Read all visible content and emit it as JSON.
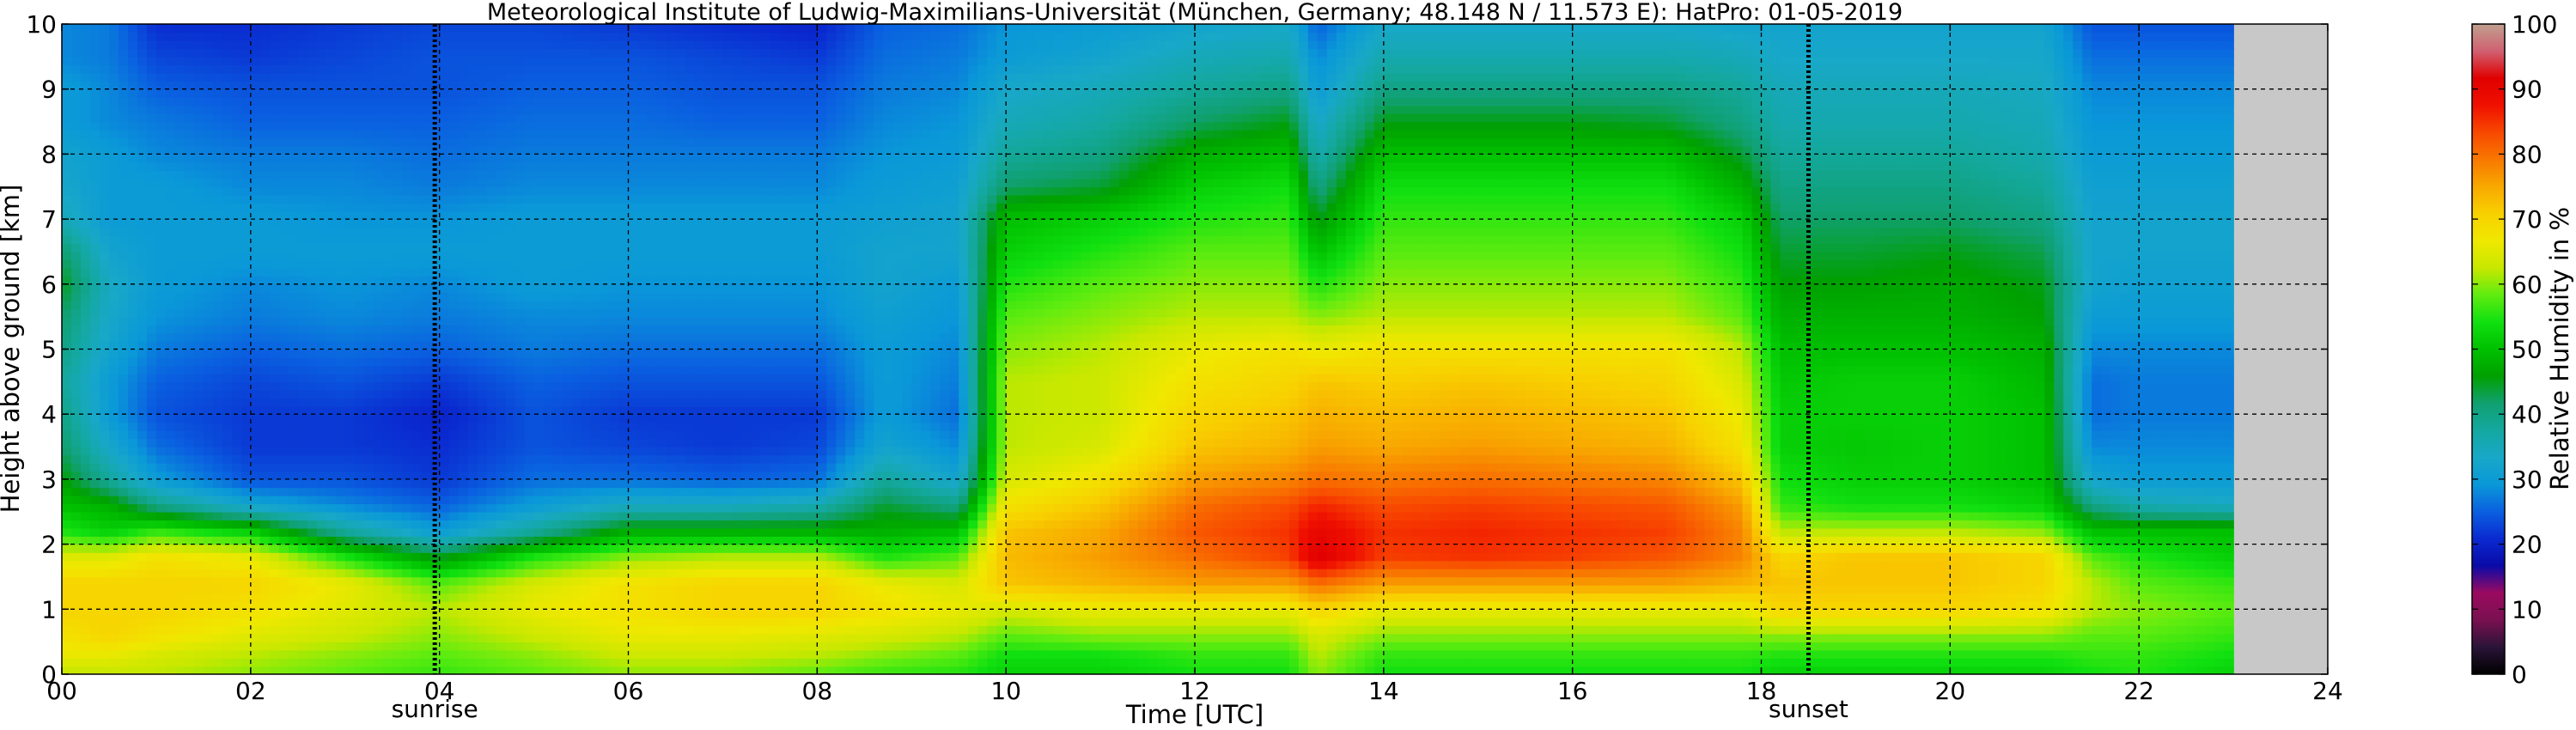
{
  "chart_data": {
    "type": "heatmap",
    "title": "Meteorological Institute of Ludwig-Maximilians-Universität (München, Germany; 48.148 N / 11.573 E):    HatPro: 01-05-2019",
    "xlabel": "Time [UTC]",
    "ylabel": "Height above ground [km]",
    "xlim": [
      0,
      24
    ],
    "ylim": [
      0,
      10
    ],
    "x_ticks": [
      0,
      2,
      4,
      6,
      8,
      10,
      12,
      14,
      16,
      18,
      20,
      22,
      24
    ],
    "x_tick_labels": [
      "00",
      "02",
      "04",
      "06",
      "08",
      "10",
      "12",
      "14",
      "16",
      "18",
      "20",
      "22",
      "24"
    ],
    "y_ticks": [
      0,
      1,
      2,
      3,
      4,
      5,
      6,
      7,
      8,
      9,
      10
    ],
    "y_tick_labels": [
      "0",
      "1",
      "2",
      "3",
      "4",
      "5",
      "6",
      "7",
      "8",
      "9",
      "10"
    ],
    "grid": true,
    "data_end_hour": 23.0,
    "colorbar": {
      "label": "Relative Humidity in %",
      "range": [
        0,
        100
      ],
      "ticks": [
        0,
        10,
        20,
        30,
        40,
        50,
        60,
        70,
        80,
        90,
        100
      ],
      "tick_labels": [
        "0",
        "10",
        "20",
        "30",
        "40",
        "50",
        "60",
        "70",
        "80",
        "90",
        "100"
      ],
      "colors": [
        "#000000",
        "#2a1438",
        "#7a1050",
        "#9a0a60",
        "#0a0aa8",
        "#0a2ad0",
        "#0a60e0",
        "#0a98d8",
        "#18a8c8",
        "#14a8a0",
        "#10a070",
        "#00a000",
        "#00c000",
        "#10e010",
        "#60ec10",
        "#c8e800",
        "#f0e800",
        "#f8d000",
        "#f8a800",
        "#f87800",
        "#f84800",
        "#f01000",
        "#e00000",
        "#d06070",
        "#c0a090"
      ]
    },
    "annotations": [
      {
        "x": 3.95,
        "label": "sunrise"
      },
      {
        "x": 18.5,
        "label": "sunset"
      }
    ],
    "profile_heights_km": [
      0.0,
      0.3,
      0.6,
      1.0,
      1.4,
      1.8,
      2.2,
      2.6,
      3.0,
      3.5,
      4.0,
      4.5,
      5.0,
      5.5,
      6.0,
      6.5,
      7.0,
      7.5,
      8.0,
      8.5,
      9.0,
      9.5,
      10.0
    ],
    "profiles": [
      {
        "time": 0.0,
        "rh": [
          62,
          66,
          68,
          70,
          70,
          65,
          55,
          50,
          46,
          42,
          40,
          38,
          40,
          42,
          45,
          42,
          35,
          33,
          32,
          30,
          30,
          28,
          28
        ]
      },
      {
        "time": 0.5,
        "rh": [
          62,
          66,
          70,
          70,
          70,
          65,
          52,
          48,
          38,
          33,
          30,
          30,
          32,
          33,
          34,
          32,
          30,
          30,
          30,
          28,
          28,
          27,
          27
        ]
      },
      {
        "time": 1.0,
        "rh": [
          62,
          64,
          68,
          70,
          70,
          68,
          56,
          40,
          30,
          26,
          24,
          25,
          27,
          29,
          30,
          30,
          30,
          30,
          28,
          27,
          25,
          23,
          21
        ]
      },
      {
        "time": 2.0,
        "rh": [
          60,
          62,
          65,
          68,
          70,
          66,
          52,
          32,
          24,
          22,
          22,
          23,
          25,
          27,
          28,
          30,
          30,
          28,
          27,
          25,
          24,
          22,
          21
        ]
      },
      {
        "time": 3.0,
        "rh": [
          58,
          60,
          63,
          65,
          66,
          55,
          38,
          28,
          24,
          22,
          22,
          24,
          26,
          28,
          29,
          30,
          29,
          28,
          27,
          25,
          24,
          23,
          22
        ]
      },
      {
        "time": 4.0,
        "rh": [
          56,
          58,
          60,
          62,
          58,
          45,
          30,
          25,
          22,
          21,
          20,
          22,
          25,
          27,
          28,
          30,
          29,
          27,
          26,
          25,
          24,
          24,
          23
        ]
      },
      {
        "time": 5.0,
        "rh": [
          58,
          60,
          63,
          66,
          64,
          55,
          38,
          30,
          26,
          24,
          24,
          25,
          27,
          28,
          30,
          30,
          30,
          28,
          27,
          26,
          25,
          24,
          23
        ]
      },
      {
        "time": 6.0,
        "rh": [
          60,
          63,
          66,
          68,
          68,
          60,
          48,
          34,
          26,
          23,
          22,
          24,
          26,
          28,
          29,
          30,
          30,
          28,
          27,
          26,
          25,
          24,
          22
        ]
      },
      {
        "time": 7.0,
        "rh": [
          60,
          63,
          66,
          70,
          70,
          62,
          48,
          34,
          25,
          22,
          22,
          24,
          26,
          28,
          29,
          30,
          30,
          28,
          27,
          25,
          24,
          23,
          21
        ]
      },
      {
        "time": 8.0,
        "rh": [
          58,
          62,
          65,
          70,
          70,
          62,
          48,
          36,
          26,
          23,
          22,
          24,
          26,
          28,
          29,
          30,
          30,
          28,
          27,
          25,
          24,
          22,
          20
        ]
      },
      {
        "time": 8.7,
        "rh": [
          56,
          60,
          64,
          68,
          66,
          55,
          48,
          44,
          38,
          32,
          30,
          30,
          30,
          31,
          32,
          32,
          31,
          30,
          29,
          28,
          27,
          26,
          25
        ]
      },
      {
        "time": 9.5,
        "rh": [
          55,
          58,
          62,
          66,
          64,
          58,
          50,
          40,
          32,
          28,
          26,
          27,
          28,
          29,
          30,
          32,
          32,
          31,
          30,
          29,
          28,
          27,
          26
        ]
      },
      {
        "time": 10.0,
        "rh": [
          52,
          54,
          58,
          64,
          72,
          73,
          72,
          68,
          64,
          62,
          62,
          62,
          60,
          58,
          55,
          52,
          50,
          42,
          38,
          35,
          33,
          30,
          29
        ]
      },
      {
        "time": 11.0,
        "rh": [
          52,
          54,
          60,
          66,
          74,
          76,
          75,
          72,
          68,
          64,
          63,
          63,
          62,
          60,
          58,
          55,
          52,
          44,
          40,
          37,
          35,
          32,
          30
        ]
      },
      {
        "time": 12.0,
        "rh": [
          54,
          56,
          60,
          66,
          76,
          80,
          82,
          80,
          76,
          72,
          70,
          68,
          66,
          62,
          60,
          58,
          55,
          52,
          48,
          42,
          38,
          35,
          32
        ]
      },
      {
        "time": 13.0,
        "rh": [
          54,
          56,
          60,
          66,
          76,
          84,
          85,
          83,
          78,
          74,
          72,
          70,
          68,
          62,
          60,
          58,
          56,
          54,
          50,
          45,
          40,
          36,
          33
        ]
      },
      {
        "time": 13.3,
        "rh": [
          60,
          62,
          64,
          70,
          80,
          92,
          90,
          86,
          80,
          76,
          74,
          72,
          66,
          60,
          55,
          50,
          45,
          40,
          36,
          33,
          30,
          28,
          25
        ]
      },
      {
        "time": 14.0,
        "rh": [
          54,
          56,
          60,
          66,
          76,
          84,
          85,
          83,
          79,
          75,
          73,
          71,
          68,
          62,
          60,
          58,
          56,
          54,
          50,
          45,
          40,
          36,
          33
        ]
      },
      {
        "time": 15.0,
        "rh": [
          54,
          56,
          60,
          66,
          76,
          85,
          86,
          84,
          80,
          76,
          74,
          72,
          68,
          62,
          60,
          58,
          56,
          54,
          50,
          45,
          40,
          36,
          33
        ]
      },
      {
        "time": 16.0,
        "rh": [
          54,
          56,
          60,
          66,
          76,
          84,
          85,
          83,
          79,
          75,
          73,
          71,
          68,
          62,
          60,
          58,
          56,
          54,
          50,
          45,
          40,
          36,
          33
        ]
      },
      {
        "time": 17.0,
        "rh": [
          54,
          56,
          60,
          66,
          76,
          82,
          84,
          82,
          78,
          74,
          72,
          70,
          68,
          62,
          60,
          58,
          56,
          54,
          50,
          44,
          40,
          36,
          33
        ]
      },
      {
        "time": 17.8,
        "rh": [
          54,
          56,
          60,
          66,
          74,
          78,
          78,
          76,
          72,
          68,
          66,
          64,
          62,
          58,
          56,
          54,
          52,
          48,
          44,
          40,
          38,
          35,
          32
        ]
      },
      {
        "time": 18.2,
        "rh": [
          52,
          55,
          60,
          70,
          72,
          70,
          62,
          56,
          54,
          52,
          52,
          51,
          50,
          48,
          46,
          44,
          42,
          40,
          38,
          36,
          35,
          33,
          32
        ]
      },
      {
        "time": 19.0,
        "rh": [
          52,
          55,
          60,
          70,
          72,
          72,
          62,
          54,
          52,
          51,
          52,
          52,
          50,
          48,
          46,
          44,
          42,
          40,
          38,
          36,
          35,
          33,
          32
        ]
      },
      {
        "time": 20.0,
        "rh": [
          52,
          55,
          60,
          70,
          72,
          72,
          62,
          54,
          52,
          52,
          52,
          52,
          50,
          48,
          47,
          45,
          42,
          40,
          38,
          36,
          35,
          33,
          32
        ]
      },
      {
        "time": 21.0,
        "rh": [
          52,
          55,
          60,
          68,
          70,
          70,
          60,
          52,
          50,
          50,
          50,
          49,
          48,
          46,
          45,
          43,
          40,
          38,
          36,
          35,
          34,
          33,
          32
        ]
      },
      {
        "time": 21.5,
        "rh": [
          54,
          56,
          58,
          62,
          62,
          58,
          50,
          40,
          32,
          28,
          26,
          26,
          28,
          30,
          32,
          32,
          32,
          31,
          30,
          29,
          28,
          26,
          24
        ]
      },
      {
        "time": 22.0,
        "rh": [
          55,
          56,
          58,
          60,
          58,
          55,
          50,
          36,
          30,
          28,
          27,
          27,
          28,
          30,
          31,
          32,
          32,
          31,
          30,
          29,
          28,
          26,
          24
        ]
      },
      {
        "time": 23.0,
        "rh": [
          52,
          54,
          56,
          58,
          56,
          52,
          50,
          34,
          30,
          28,
          27,
          27,
          28,
          30,
          31,
          32,
          32,
          31,
          30,
          29,
          28,
          26,
          24
        ]
      }
    ]
  }
}
